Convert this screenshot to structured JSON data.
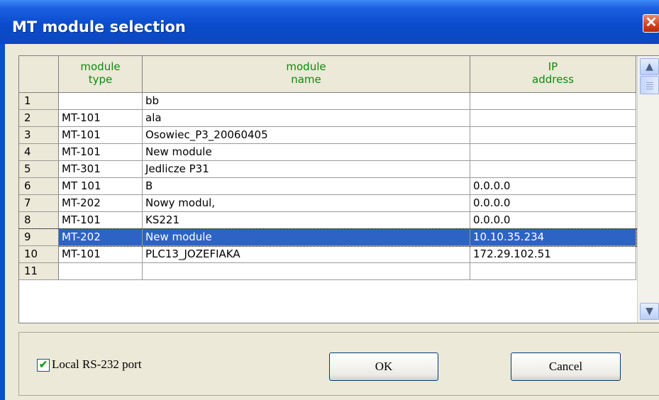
{
  "window": {
    "title": "MT module selection",
    "close_label": "✕"
  },
  "grid": {
    "columns": [
      {
        "line1": "module",
        "line2": "type"
      },
      {
        "line1": "module",
        "line2": "name"
      },
      {
        "line1": "IP",
        "line2": "address"
      }
    ],
    "rows": [
      {
        "num": "1",
        "type": "",
        "name": "bb",
        "ip": ""
      },
      {
        "num": "2",
        "type": "MT-101",
        "name": "ala",
        "ip": ""
      },
      {
        "num": "3",
        "type": "MT-101",
        "name": "Osowiec_P3_20060405",
        "ip": ""
      },
      {
        "num": "4",
        "type": "MT-101",
        "name": "New module",
        "ip": ""
      },
      {
        "num": "5",
        "type": "MT-301",
        "name": "Jedlicze P31",
        "ip": ""
      },
      {
        "num": "6",
        "type": "MT 101",
        "name": "B",
        "ip": "0.0.0.0"
      },
      {
        "num": "7",
        "type": "MT-202",
        "name": "Nowy modul,",
        "ip": "0.0.0.0"
      },
      {
        "num": "8",
        "type": "MT-101",
        "name": "KS221",
        "ip": "0.0.0.0"
      },
      {
        "num": "9",
        "type": "MT-202",
        "name": "New module",
        "ip": "10.10.35.234"
      },
      {
        "num": "10",
        "type": "MT-101",
        "name": "PLC13_JOZEFIAKA",
        "ip": "172.29.102.51"
      },
      {
        "num": "11",
        "type": "",
        "name": "",
        "ip": ""
      }
    ],
    "selected_row": "9",
    "scroll": {
      "up_icon": "▲",
      "down_icon": "▼"
    }
  },
  "footer": {
    "checkbox_label": "Local RS-232 port",
    "checkbox_checked": true,
    "check_mark": "✔",
    "ok_label": "OK",
    "cancel_label": "Cancel"
  },
  "colors": {
    "titlebar": "#0a4ccd",
    "header_text": "#0f8a0f",
    "selection": "#2c63c4"
  }
}
